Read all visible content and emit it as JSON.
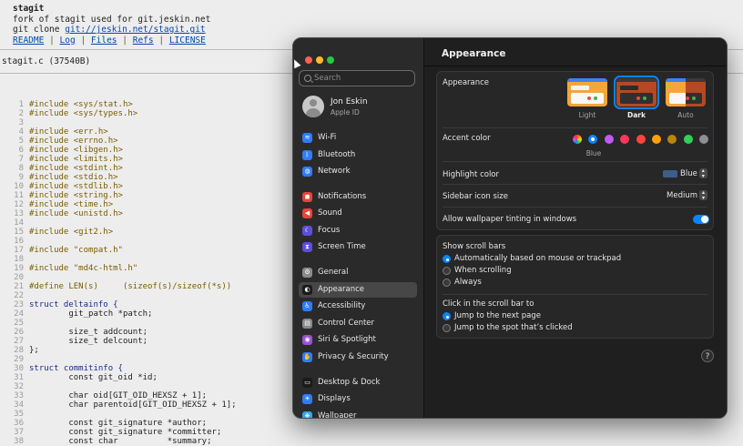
{
  "background": {
    "repo_name": "stagit",
    "description": "fork of stagit used for git.jeskin.net",
    "clone_prefix": "git clone",
    "clone_url": "git://jeskin.net/stagit.git",
    "links": [
      "README",
      "Log",
      "Files",
      "Refs",
      "LICENSE"
    ],
    "link_sep": "|",
    "file_title": "stagit.c (37540B)",
    "code_lines": [
      {
        "n": "1",
        "t": "#include <sys/stat.h>",
        "c": "pp"
      },
      {
        "n": "2",
        "t": "#include <sys/types.h>",
        "c": "pp"
      },
      {
        "n": "3",
        "t": "",
        "c": ""
      },
      {
        "n": "4",
        "t": "#include <err.h>",
        "c": "pp"
      },
      {
        "n": "5",
        "t": "#include <errno.h>",
        "c": "pp"
      },
      {
        "n": "6",
        "t": "#include <libgen.h>",
        "c": "pp"
      },
      {
        "n": "7",
        "t": "#include <limits.h>",
        "c": "pp"
      },
      {
        "n": "8",
        "t": "#include <stdint.h>",
        "c": "pp"
      },
      {
        "n": "9",
        "t": "#include <stdio.h>",
        "c": "pp"
      },
      {
        "n": "10",
        "t": "#include <stdlib.h>",
        "c": "pp"
      },
      {
        "n": "11",
        "t": "#include <string.h>",
        "c": "pp"
      },
      {
        "n": "12",
        "t": "#include <time.h>",
        "c": "pp"
      },
      {
        "n": "13",
        "t": "#include <unistd.h>",
        "c": "pp"
      },
      {
        "n": "14",
        "t": "",
        "c": ""
      },
      {
        "n": "15",
        "t": "#include <git2.h>",
        "c": "pp"
      },
      {
        "n": "16",
        "t": "",
        "c": ""
      },
      {
        "n": "17",
        "t": "#include \"compat.h\"",
        "c": "pp"
      },
      {
        "n": "18",
        "t": "",
        "c": ""
      },
      {
        "n": "19",
        "t": "#include \"md4c-html.h\"",
        "c": "pp"
      },
      {
        "n": "20",
        "t": "",
        "c": ""
      },
      {
        "n": "21",
        "t": "#define LEN(s)     (sizeof(s)/sizeof(*s))",
        "c": "pp"
      },
      {
        "n": "22",
        "t": "",
        "c": ""
      },
      {
        "n": "23",
        "t": "struct deltainfo {",
        "c": "kw"
      },
      {
        "n": "24",
        "t": "        git_patch *patch;",
        "c": ""
      },
      {
        "n": "25",
        "t": "",
        "c": ""
      },
      {
        "n": "26",
        "t": "        size_t addcount;",
        "c": ""
      },
      {
        "n": "27",
        "t": "        size_t delcount;",
        "c": ""
      },
      {
        "n": "28",
        "t": "};",
        "c": ""
      },
      {
        "n": "29",
        "t": "",
        "c": ""
      },
      {
        "n": "30",
        "t": "struct commitinfo {",
        "c": "kw"
      },
      {
        "n": "31",
        "t": "        const git_oid *id;",
        "c": ""
      },
      {
        "n": "32",
        "t": "",
        "c": ""
      },
      {
        "n": "33",
        "t": "        char oid[GIT_OID_HEXSZ + 1];",
        "c": ""
      },
      {
        "n": "34",
        "t": "        char parentoid[GIT_OID_HEXSZ + 1];",
        "c": ""
      },
      {
        "n": "35",
        "t": "",
        "c": ""
      },
      {
        "n": "36",
        "t": "        const git_signature *author;",
        "c": ""
      },
      {
        "n": "37",
        "t": "        const git_signature *committer;",
        "c": ""
      },
      {
        "n": "38",
        "t": "        const char          *summary;",
        "c": ""
      }
    ]
  },
  "window": {
    "search_placeholder": "Search",
    "user": {
      "name": "Jon Eskin",
      "subtitle": "Apple ID"
    },
    "sidebar_items": [
      {
        "label": "Wi-Fi",
        "icon": "wifi-icon",
        "color": "#2f7cf6",
        "glyph": "≋"
      },
      {
        "label": "Bluetooth",
        "icon": "bluetooth-icon",
        "color": "#2f7cf6",
        "glyph": "ᛒ"
      },
      {
        "label": "Network",
        "icon": "network-icon",
        "color": "#2f7cf6",
        "glyph": "◍"
      },
      {
        "label": "Notifications",
        "icon": "notifications-icon",
        "color": "#e8433b",
        "glyph": "◼"
      },
      {
        "label": "Sound",
        "icon": "sound-icon",
        "color": "#e8433b",
        "glyph": "◀"
      },
      {
        "label": "Focus",
        "icon": "focus-icon",
        "color": "#5d4fd6",
        "glyph": "☾"
      },
      {
        "label": "Screen Time",
        "icon": "screen-time-icon",
        "color": "#5d4fd6",
        "glyph": "⧗"
      },
      {
        "label": "General",
        "icon": "gear-icon",
        "color": "#8a8a8a",
        "glyph": "⚙"
      },
      {
        "label": "Appearance",
        "icon": "appearance-icon",
        "color": "#1a1a1a",
        "glyph": "◐"
      },
      {
        "label": "Accessibility",
        "icon": "accessibility-icon",
        "color": "#2f7cf6",
        "glyph": "♿"
      },
      {
        "label": "Control Center",
        "icon": "control-center-icon",
        "color": "#8a8a8a",
        "glyph": "▤"
      },
      {
        "label": "Siri & Spotlight",
        "icon": "siri-icon",
        "color": "#9b4fd6",
        "glyph": "◉"
      },
      {
        "label": "Privacy & Security",
        "icon": "privacy-hand-icon",
        "color": "#2f7cf6",
        "glyph": "✋"
      },
      {
        "label": "Desktop & Dock",
        "icon": "desktop-dock-icon",
        "color": "#1a1a1a",
        "glyph": "▭"
      },
      {
        "label": "Displays",
        "icon": "displays-icon",
        "color": "#2f7cf6",
        "glyph": "☀"
      },
      {
        "label": "Wallpaper",
        "icon": "wallpaper-icon",
        "color": "#2fa6e8",
        "glyph": "❋"
      }
    ],
    "selected_item": "Appearance",
    "page_title": "Appearance",
    "appearance_label": "Appearance",
    "appearance_options": [
      "Light",
      "Dark",
      "Auto"
    ],
    "appearance_selected": "Dark",
    "accent_label": "Accent color",
    "accent_colors": [
      "multicolor",
      "#0a84ff",
      "#bf5af2",
      "#ff375f",
      "#ff453a",
      "#ff9f0a",
      "#b8860b",
      "#30d158",
      "#8e8e93"
    ],
    "accent_selected_name": "Blue",
    "highlight_label": "Highlight color",
    "highlight_value": "Blue",
    "highlight_swatch": "#3a5f8a",
    "sidebar_icon_label": "Sidebar icon size",
    "sidebar_icon_value": "Medium",
    "tinting_label": "Allow wallpaper tinting in windows",
    "tinting_on": true,
    "scrollbars_label": "Show scroll bars",
    "scrollbar_options": [
      "Automatically based on mouse or trackpad",
      "When scrolling",
      "Always"
    ],
    "scrollbar_selected": 0,
    "click_label": "Click in the scroll bar to",
    "click_options": [
      "Jump to the next page",
      "Jump to the spot that’s clicked"
    ],
    "click_selected": 0,
    "help": "?"
  }
}
